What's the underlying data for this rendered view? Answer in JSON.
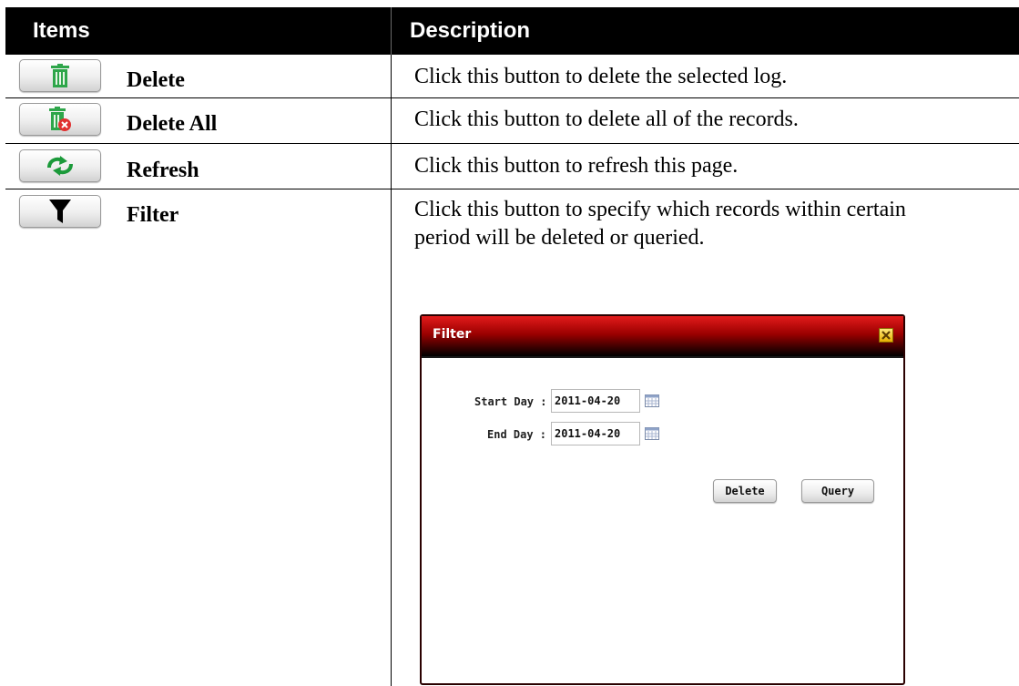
{
  "table": {
    "headers": {
      "items": "Items",
      "description": "Description"
    },
    "rows": [
      {
        "label": "Delete",
        "icon": "trash-icon",
        "description": "Click this button to delete the selected log."
      },
      {
        "label": "Delete All",
        "icon": "trash-delete-all-icon",
        "description": "Click this button to delete all of the records."
      },
      {
        "label": "Refresh",
        "icon": "refresh-icon",
        "description": "Click this button to refresh this page."
      },
      {
        "label": "Filter",
        "icon": "filter-funnel-icon",
        "description": "Click this button to specify which records within certain period will be deleted or queried."
      }
    ]
  },
  "dialog": {
    "title": "Filter",
    "start_label": "Start Day :",
    "start_value": "2011-04-20",
    "end_label": "End Day :",
    "end_value": "2011-04-20",
    "delete_button": "Delete",
    "query_button": "Query"
  },
  "colors": {
    "trash_green": "#2ea64a",
    "refresh_green": "#1b9a3a",
    "title_red": "#c00000",
    "header_black": "#000000"
  }
}
